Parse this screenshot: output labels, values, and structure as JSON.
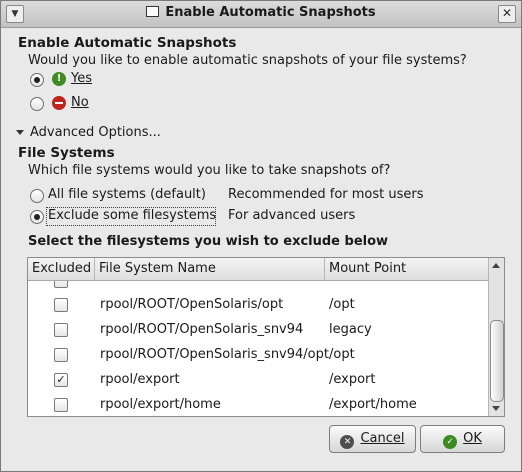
{
  "window": {
    "title": "Enable Automatic Snapshots",
    "menu_glyph": "▼",
    "close_glyph": "✕"
  },
  "section1": {
    "heading": "Enable Automatic Snapshots",
    "question": "Would you like to enable automatic snapshots of your file systems?",
    "yes_label": "Yes",
    "no_label": "No",
    "selected": "Yes"
  },
  "advanced": {
    "label": "Advanced Options..."
  },
  "section2": {
    "heading": "File Systems",
    "question": "Which file systems would you like to take snapshots of?",
    "option_all": {
      "label": "All file systems (default)",
      "description": "Recommended for most users"
    },
    "option_exclude": {
      "label": "Exclude some filesystems",
      "description": "For advanced users"
    },
    "selected": "Exclude some filesystems",
    "table_heading": "Select the filesystems you wish to exclude below"
  },
  "table": {
    "columns": [
      "Excluded",
      "File System Name",
      "Mount Point"
    ],
    "rows": [
      {
        "excluded": false,
        "name": "rpool/ROOT/OpenSolaris/opt",
        "mount": "/opt"
      },
      {
        "excluded": false,
        "name": "rpool/ROOT/OpenSolaris_snv94",
        "mount": "legacy"
      },
      {
        "excluded": false,
        "name": "rpool/ROOT/OpenSolaris_snv94/opt",
        "mount": "/opt"
      },
      {
        "excluded": true,
        "name": "rpool/export",
        "mount": "/export"
      },
      {
        "excluded": false,
        "name": "rpool/export/home",
        "mount": "/export/home"
      }
    ]
  },
  "buttons": {
    "cancel": "Cancel",
    "ok": "OK"
  },
  "colors": {
    "yes_icon": "#3f8a24",
    "no_icon": "#c0251d",
    "ok_icon": "#3e8a22"
  }
}
